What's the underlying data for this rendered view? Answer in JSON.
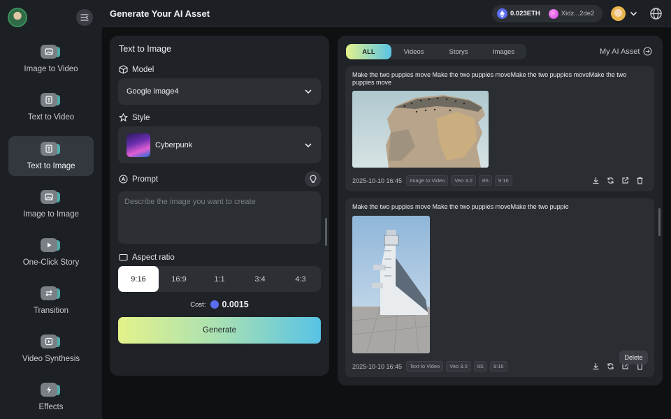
{
  "header": {
    "title": "Generate Your AI Asset",
    "wallet_amount": "0.023ETH",
    "wallet_address": "Xidz...2de2"
  },
  "sidebar": {
    "items": [
      {
        "label": "Image to Video",
        "icon": "image-icon"
      },
      {
        "label": "Text to Video",
        "icon": "text-icon"
      },
      {
        "label": "Text to Image",
        "icon": "text-icon",
        "active": true
      },
      {
        "label": "Image to Image",
        "icon": "image-icon"
      },
      {
        "label": "One-Click Story",
        "icon": "play-icon"
      },
      {
        "label": "Transition",
        "icon": "swap-icon"
      },
      {
        "label": "Video Synthesis",
        "icon": "play-icon"
      },
      {
        "label": "Effects",
        "icon": "bolt-icon"
      }
    ]
  },
  "form": {
    "title": "Text to Image",
    "model_label": "Model",
    "model_value": "Google image4",
    "style_label": "Style",
    "style_value": "Cyberpunk",
    "prompt_label": "Prompt",
    "prompt_placeholder": "Describe the image you want to create",
    "aspect_label": "Aspect ratio",
    "ratios": [
      "9:16",
      "16:9",
      "1:1",
      "3:4",
      "4:3"
    ],
    "ratio_selected": "9:16",
    "cost_label": "Cost:",
    "cost_value": "0.0015",
    "generate_label": "Generate"
  },
  "gallery": {
    "tabs": [
      "ALL",
      "Videos",
      "Storys",
      "Images"
    ],
    "active_tab": "ALL",
    "my_asset_label": "My AI Asset",
    "cards": [
      {
        "prompt": "Make the two puppies move Make the two puppies moveMake the two puppies moveMake the two puppies move",
        "date": "2025-10-10 16:45",
        "tags": [
          "Image to Video",
          "Veo 3.0",
          "8S",
          "9:16"
        ]
      },
      {
        "prompt": "Make the two puppies move Make the two puppies moveMake the two puppie",
        "date": "2025-10-10 16:45",
        "tags": [
          "Text to Video",
          "Veo 3.0",
          "8S",
          "9:16"
        ]
      }
    ],
    "tooltip": "Delete"
  },
  "colors": {
    "accent_start": "#e4f28a",
    "accent_end": "#58c3e4",
    "eth": "#5a6df0"
  }
}
